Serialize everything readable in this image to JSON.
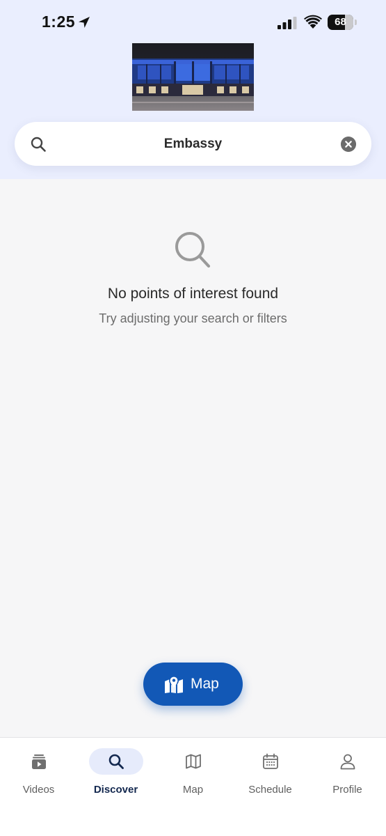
{
  "status_bar": {
    "time": "1:25",
    "battery": "68",
    "battery_level": 0.68
  },
  "search": {
    "query": "Embassy"
  },
  "empty_state": {
    "title": "No points of interest found",
    "subtitle": "Try adjusting your search or filters"
  },
  "map_button": {
    "label": "Map"
  },
  "tabs": [
    {
      "label": "Videos",
      "icon": "video-icon",
      "active": false
    },
    {
      "label": "Discover",
      "icon": "search-icon",
      "active": true
    },
    {
      "label": "Map",
      "icon": "map-icon",
      "active": false
    },
    {
      "label": "Schedule",
      "icon": "calendar-icon",
      "active": false
    },
    {
      "label": "Profile",
      "icon": "person-icon",
      "active": false
    }
  ],
  "colors": {
    "accent": "#1258b6",
    "header_background": "#eaeefe",
    "active_tab_pill": "#e6ebfb",
    "active_tab_text": "#13284f"
  }
}
